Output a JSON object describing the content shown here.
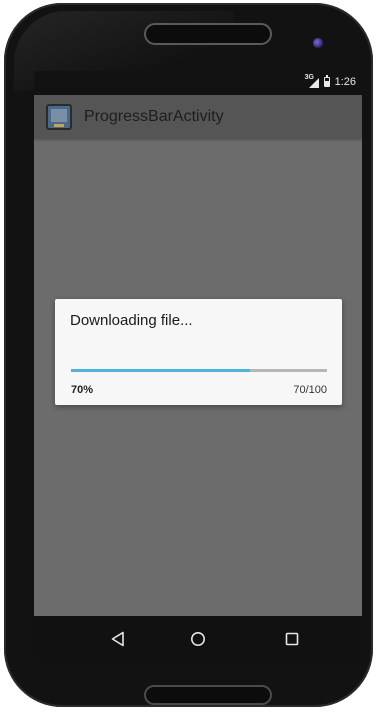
{
  "status_bar": {
    "network_label": "3G",
    "time": "1:26"
  },
  "action_bar": {
    "title": "ProgressBarActivity",
    "icon": "app-launcher-icon"
  },
  "dialog": {
    "message": "Downloading file...",
    "progress_fraction": 0.7,
    "progress_percent_label": "70%",
    "progress_count_label": "70/100",
    "accent_color": "#4fb5dc"
  },
  "nav_bar": {
    "back_icon": "back-triangle-icon",
    "home_icon": "home-circle-icon",
    "recent_icon": "recent-apps-square-icon"
  }
}
